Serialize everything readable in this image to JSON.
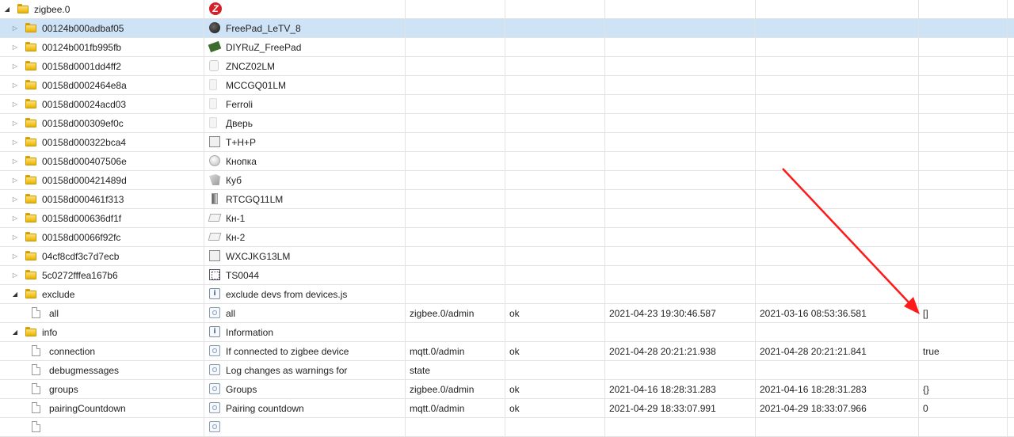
{
  "colors": {
    "selected_row": "#cfe3f7",
    "arrow": "#ff1a1a",
    "zigbee_logo": "#d42026"
  },
  "tree": {
    "root": {
      "id": "zigbee.0",
      "logo": "Z"
    },
    "devices": [
      {
        "id": "00124b000adbaf05",
        "name": "FreePad_LeTV_8",
        "icon": "remote-dark-icon"
      },
      {
        "id": "00124b001fb995fb",
        "name": "DIYRuZ_FreePad",
        "icon": "pcb-board-icon"
      },
      {
        "id": "00158d0001dd4ff2",
        "name": "ZNCZ02LM",
        "icon": "plug-icon"
      },
      {
        "id": "00158d0002464e8a",
        "name": "MCCGQ01LM",
        "icon": "door-sensor-icon"
      },
      {
        "id": "00158d00024acd03",
        "name": "Ferroli",
        "icon": "sensor-icon"
      },
      {
        "id": "00158d000309ef0c",
        "name": "Дверь",
        "icon": "door-sensor-icon"
      },
      {
        "id": "00158d000322bca4",
        "name": "T+H+P",
        "icon": "weather-sensor-icon"
      },
      {
        "id": "00158d000407506e",
        "name": "Кнопка",
        "icon": "round-button-icon"
      },
      {
        "id": "00158d000421489d",
        "name": "Куб",
        "icon": "cube-icon"
      },
      {
        "id": "00158d000461f313",
        "name": "RTCGQ11LM",
        "icon": "motion-sensor-icon"
      },
      {
        "id": "00158d000636df1f",
        "name": "Кн-1",
        "icon": "wall-switch-icon"
      },
      {
        "id": "00158d00066f92fc",
        "name": "Кн-2",
        "icon": "wall-switch-icon"
      },
      {
        "id": "04cf8cdf3c7d7ecb",
        "name": "WXCJKG13LM",
        "icon": "switch-panel-icon"
      },
      {
        "id": "5c0272fffea167b6",
        "name": "TS0044",
        "icon": "scene-switch-icon"
      }
    ],
    "exclude": {
      "id": "exclude",
      "name": "exclude devs from devices.js",
      "children": [
        {
          "id": "all",
          "name": "all",
          "from": "zigbee.0/admin",
          "ack": "ok",
          "ts": "2021-04-23 19:30:46.587",
          "lc": "2021-03-16 08:53:36.581",
          "value": "[]"
        }
      ]
    },
    "info": {
      "id": "info",
      "name": "Information",
      "children": [
        {
          "id": "connection",
          "name": "If connected to zigbee device",
          "from": "mqtt.0/admin",
          "ack": "ok",
          "ts": "2021-04-28 20:21:21.938",
          "lc": "2021-04-28 20:21:21.841",
          "value": "true"
        },
        {
          "id": "debugmessages",
          "name": "Log changes as warnings for",
          "from": "state",
          "ack": "",
          "ts": "",
          "lc": "",
          "value": ""
        },
        {
          "id": "groups",
          "name": "Groups",
          "from": "zigbee.0/admin",
          "ack": "ok",
          "ts": "2021-04-16 18:28:31.283",
          "lc": "2021-04-16 18:28:31.283",
          "value": "{}"
        },
        {
          "id": "pairingCountdown",
          "name": "Pairing countdown",
          "from": "mqtt.0/admin",
          "ack": "ok",
          "ts": "2021-04-29 18:33:07.991",
          "lc": "2021-04-29 18:33:07.966",
          "value": "0"
        }
      ]
    }
  }
}
